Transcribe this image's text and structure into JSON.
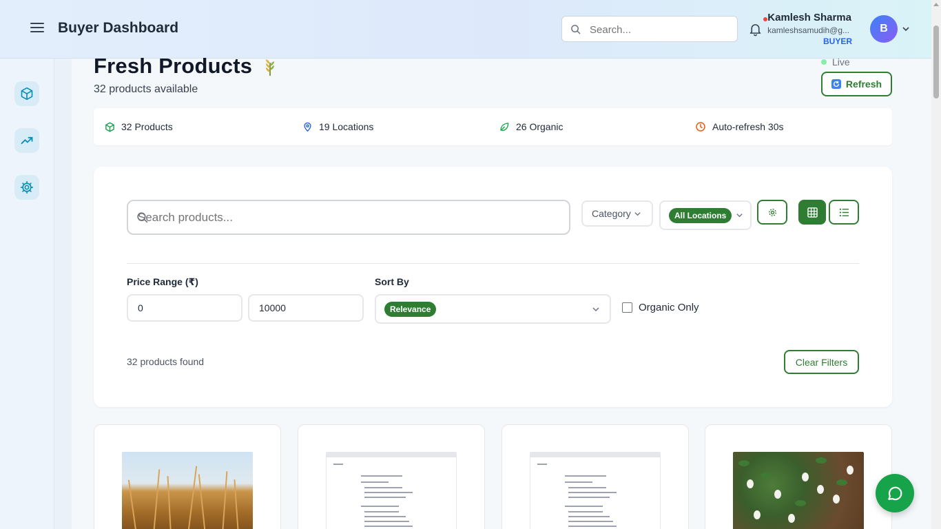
{
  "header": {
    "title": "Buyer Dashboard",
    "search_placeholder": "Search...",
    "user": {
      "name": "Kamlesh Sharma",
      "email": "kamleshsamudih@g...",
      "role": "BUYER",
      "avatar_initial": "B"
    },
    "notification_dot_color": "#ef4444"
  },
  "sidebar": {
    "items": [
      {
        "icon": "box-icon"
      },
      {
        "icon": "trending-up-icon"
      },
      {
        "icon": "gear-icon"
      }
    ]
  },
  "page": {
    "title": "Fresh Products",
    "subtitle": "32 products available",
    "live_label": "Live",
    "refresh_label": "Refresh"
  },
  "stats": {
    "products": "32 Products",
    "locations": "19 Locations",
    "organic": "26 Organic",
    "auto_refresh": "Auto-refresh 30s"
  },
  "filters": {
    "search_placeholder": "Search products...",
    "category_label": "Category",
    "location_value": "All Locations",
    "price_range_label": "Price Range (₹)",
    "price_min": "0",
    "price_max": "10000",
    "sort_label": "Sort By",
    "sort_value": "Relevance",
    "organic_only_label": "Organic Only",
    "organic_only_checked": false,
    "results_text": "32 products found",
    "clear_label": "Clear Filters",
    "view_mode": "grid"
  },
  "products": [
    {
      "image": "wheat-field-photo"
    },
    {
      "image": "document-screenshot"
    },
    {
      "image": "document-screenshot"
    },
    {
      "image": "cotton-plant-photo"
    }
  ],
  "colors": {
    "primary_green": "#2e7d32",
    "accent_blue": "#2563eb",
    "chat_fab": "#16a34a"
  }
}
